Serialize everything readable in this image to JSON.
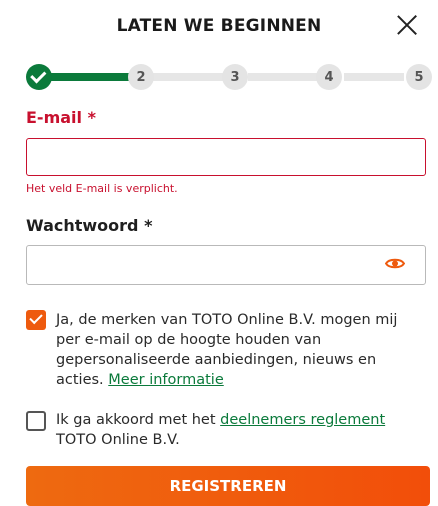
{
  "header": {
    "title": "LATEN WE BEGINNEN"
  },
  "stepper": {
    "current_step": 1,
    "steps": [
      {
        "number": "",
        "status": "done"
      },
      {
        "number": "2",
        "status": "pending"
      },
      {
        "number": "3",
        "status": "pending"
      },
      {
        "number": "4",
        "status": "pending"
      },
      {
        "number": "5",
        "status": "pending"
      }
    ]
  },
  "form": {
    "email_label": "E-mail *",
    "email_value": "",
    "email_error": "Het veld E-mail is verplicht.",
    "password_label": "Wachtwoord *",
    "password_value": "",
    "consent_marketing": {
      "checked": true,
      "text": "Ja, de merken van TOTO Online B.V. mogen mij per e-mail op de hoogte houden van gepersonaliseerde aanbiedingen, nieuws en acties.",
      "link": "Meer informatie"
    },
    "consent_terms": {
      "checked": false,
      "text_before": "Ik ga akkoord met het",
      "link": "deelnemers reglement",
      "text_after": "TOTO Online B.V."
    },
    "submit_label": "REGISTREREN"
  },
  "colors": {
    "brand_green": "#0b7a3b",
    "brand_orange": "#ee5a0e",
    "error_red": "#c8102e"
  },
  "icons": {
    "close": "close-icon",
    "password_toggle": "eye-icon",
    "step_done": "check-icon"
  }
}
